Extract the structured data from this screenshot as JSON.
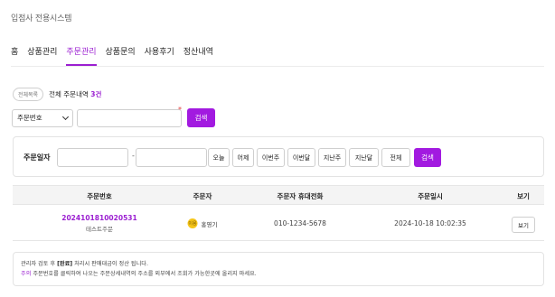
{
  "app": {
    "title": "입점사 전용시스템"
  },
  "nav": {
    "tabs": [
      {
        "label": "홈",
        "active": false
      },
      {
        "label": "상품관리",
        "active": false
      },
      {
        "label": "주문관리",
        "active": true
      },
      {
        "label": "상품문의",
        "active": false
      },
      {
        "label": "사용후기",
        "active": false
      },
      {
        "label": "정산내역",
        "active": false
      }
    ]
  },
  "summary": {
    "pill": "전체목록",
    "text_prefix": "전체 주문내역",
    "count": "3건"
  },
  "search": {
    "field_select": "주문번호",
    "keyword_value": "",
    "required_mark": "*",
    "button": "검색"
  },
  "date_filter": {
    "label": "주문일자",
    "from_value": "",
    "separator": "-",
    "to_value": "",
    "quick_buttons": [
      "오늘",
      "어제",
      "이번주",
      "이번달",
      "지난주",
      "지난달",
      "전체"
    ],
    "search_button": "검색"
  },
  "table": {
    "columns": [
      "주문번호",
      "주문자",
      "주문자 휴대전화",
      "주문일시",
      "보기"
    ],
    "rows": [
      {
        "order_no": "2024101810020531",
        "order_name": "테스트주문",
        "avatar_text": "이용",
        "orderer": "홍영기",
        "phone": "010-1234-5678",
        "datetime": "2024-10-18 10:02:35",
        "view_label": "보기"
      }
    ]
  },
  "notice": {
    "line1_prefix": "관리자 검토 후",
    "line1_bold": "[완료]",
    "line1_suffix": "처리시 판매대금이 정산 됩니다.",
    "line2_warn": "주의",
    "line2_text": "주문번호를 클릭하여 나오는 주문상세내역의 주소를 외부에서 조회가 가능한곳에 올리지 마세요."
  },
  "colors": {
    "accent": "#a21ae0",
    "required": "#e23b3b",
    "avatar": "#f5c518"
  }
}
